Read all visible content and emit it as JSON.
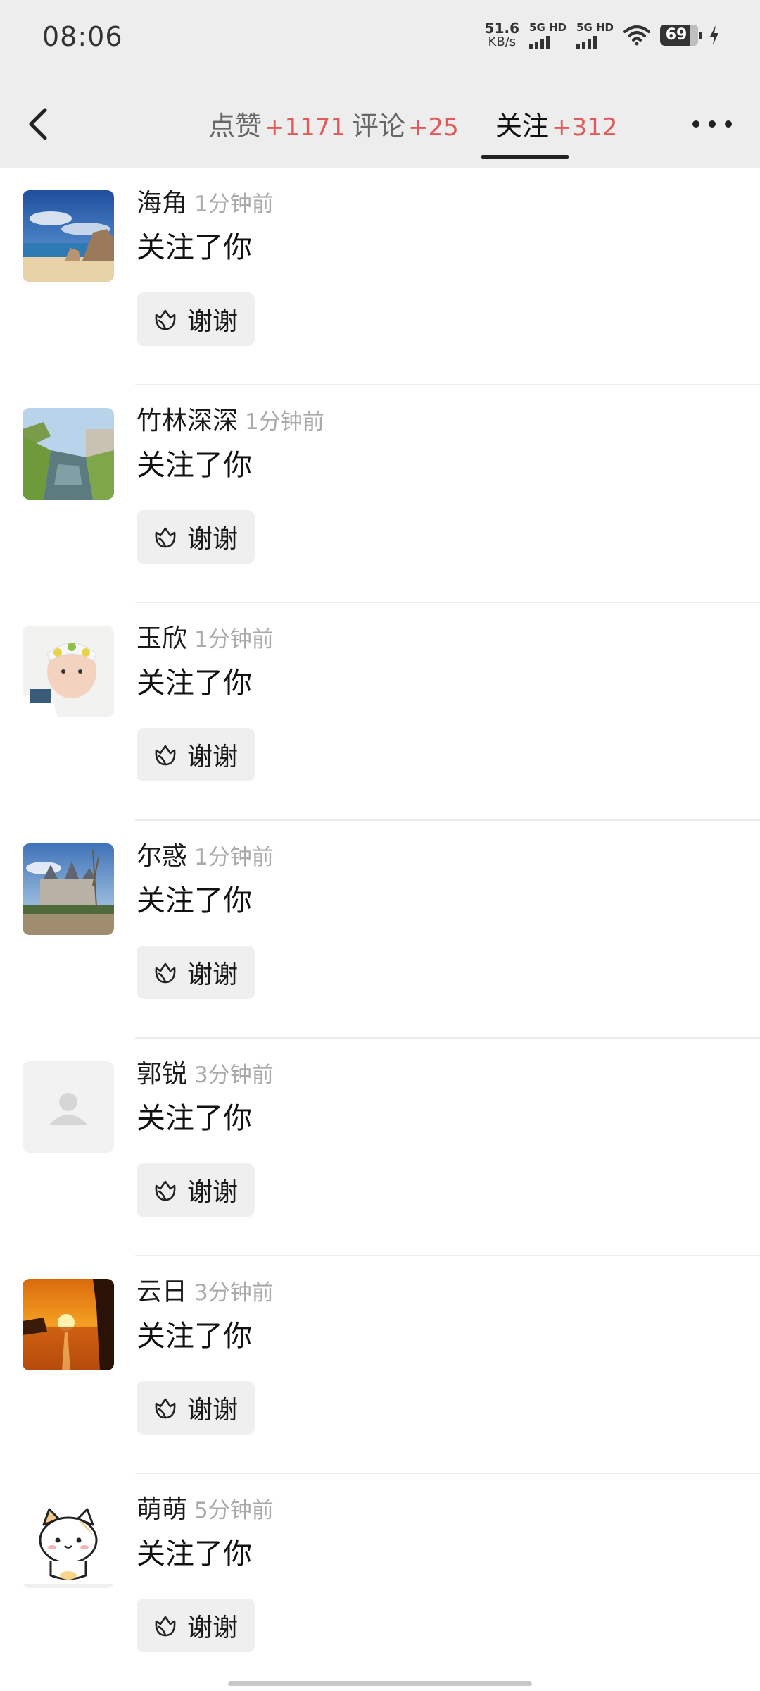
{
  "status_bar": {
    "time": "08:06",
    "net_speed": "51.6",
    "net_unit": "KB/s",
    "sim1": "5G HD",
    "sim2": "5G HD",
    "battery": "69",
    "icons": [
      "signal-icon",
      "wifi-icon",
      "battery-icon",
      "charging-icon"
    ]
  },
  "header": {
    "back_icon": "chevron-left-icon",
    "more_icon": "more-dots-icon",
    "tabs": [
      {
        "label": "点赞",
        "count": "+1171"
      },
      {
        "label": "评论",
        "count": "+25"
      },
      {
        "label": "关注",
        "count": "+312"
      }
    ],
    "active_tab": "关注"
  },
  "notifications": [
    {
      "name": "海角",
      "time": "1分钟前",
      "action": "关注了你",
      "button": "谢谢"
    },
    {
      "name": "竹林深深",
      "time": "1分钟前",
      "action": "关注了你",
      "button": "谢谢"
    },
    {
      "name": "玉欣",
      "time": "1分钟前",
      "action": "关注了你",
      "button": "谢谢"
    },
    {
      "name": "尔惑",
      "time": "1分钟前",
      "action": "关注了你",
      "button": "谢谢"
    },
    {
      "name": "郭锐",
      "time": "3分钟前",
      "action": "关注了你",
      "button": "谢谢"
    },
    {
      "name": "云日",
      "time": "3分钟前",
      "action": "关注了你",
      "button": "谢谢"
    },
    {
      "name": "萌萌",
      "time": "5分钟前",
      "action": "关注了你",
      "button": "谢谢"
    }
  ],
  "colors": {
    "accent_count": "#e05a5a",
    "background_header": "#ededed",
    "button_bg": "#efefef"
  }
}
